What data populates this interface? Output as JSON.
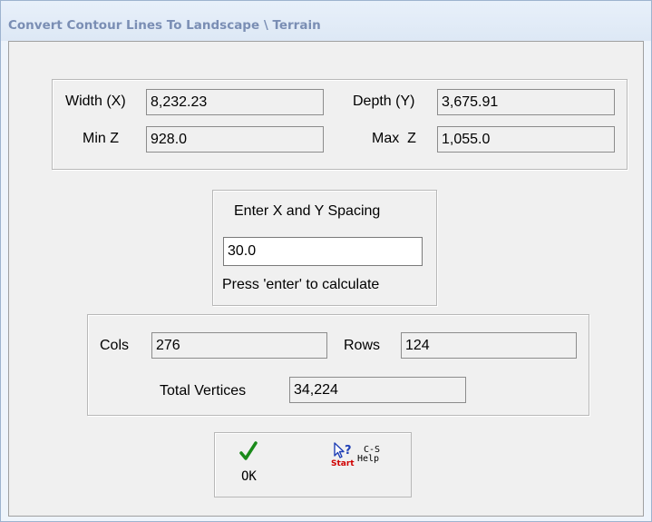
{
  "window": {
    "title": "Convert Contour Lines To Landscape \\ Terrain"
  },
  "dimensions": {
    "width_label": "Width (X)",
    "width_value": "8,232.23",
    "depth_label": "Depth (Y)",
    "depth_value": "3,675.91",
    "minz_label": "Min Z",
    "minz_value": "928.0",
    "maxz_label": "Max  Z",
    "maxz_value": "1,055.0"
  },
  "spacing": {
    "heading": "Enter X and Y Spacing",
    "value": "30.0",
    "hint": "Press 'enter' to calculate"
  },
  "grid": {
    "cols_label": "Cols",
    "cols_value": "276",
    "rows_label": "Rows",
    "rows_value": "124",
    "total_label": "Total Vertices",
    "total_value": "34,224"
  },
  "buttons": {
    "ok_label": "OK",
    "help_start": "Start",
    "help_label_line1": "C-S",
    "help_label_line2": "Help"
  },
  "colors": {
    "title_text": "#7a8eb4",
    "checkmark": "#1a8a1a",
    "start_text": "#d00000"
  },
  "icons": {
    "ok": "green-checkmark-icon",
    "help": "question-arrow-icon"
  }
}
